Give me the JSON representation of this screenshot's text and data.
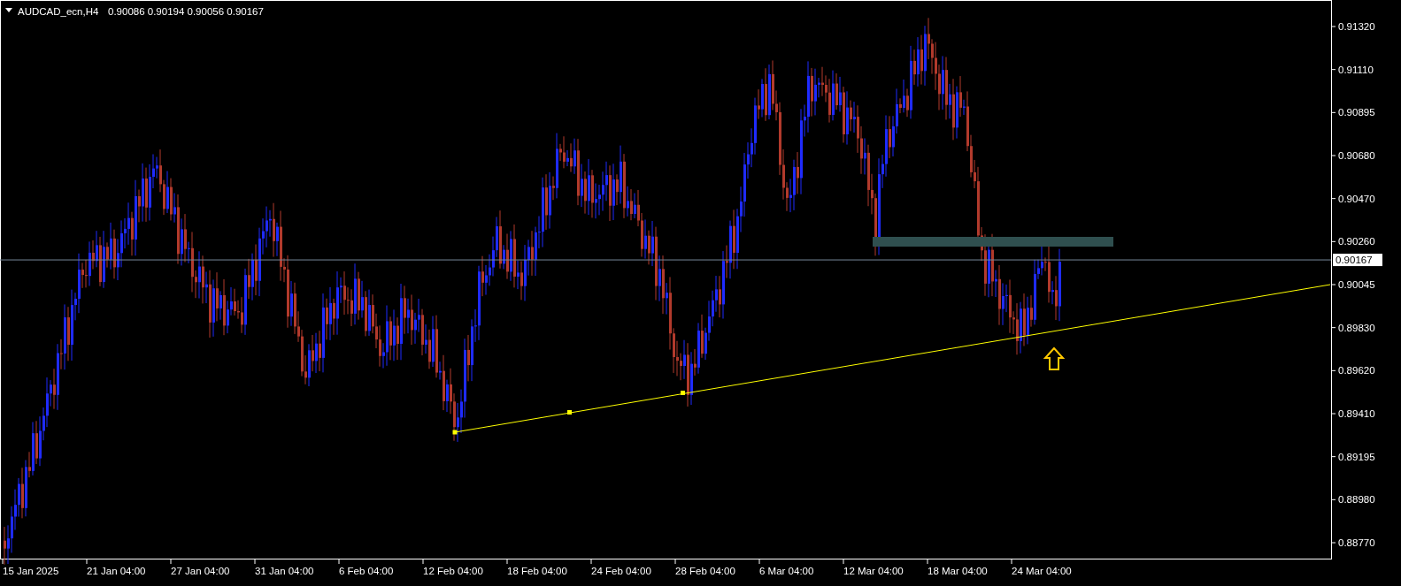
{
  "header": {
    "symbol": "AUDCAD_ecn,H4",
    "quotes": "0.90086 0.90194 0.90056 0.90167"
  },
  "price_axis": [
    "0.91320",
    "0.91110",
    "0.90895",
    "0.90680",
    "0.90470",
    "0.90260",
    "0.90045",
    "0.89830",
    "0.89620",
    "0.89410",
    "0.89195",
    "0.88980",
    "0.88770"
  ],
  "current_price": "0.90167",
  "time_axis": [
    "15 Jan 2025",
    "21 Jan 04:00",
    "27 Jan 04:00",
    "31 Jan 04:00",
    "6 Feb 04:00",
    "12 Feb 04:00",
    "18 Feb 04:00",
    "24 Feb 04:00",
    "28 Feb 04:00",
    "6 Mar 04:00",
    "12 Mar 04:00",
    "18 Mar 04:00",
    "24 Mar 04:00"
  ]
}
